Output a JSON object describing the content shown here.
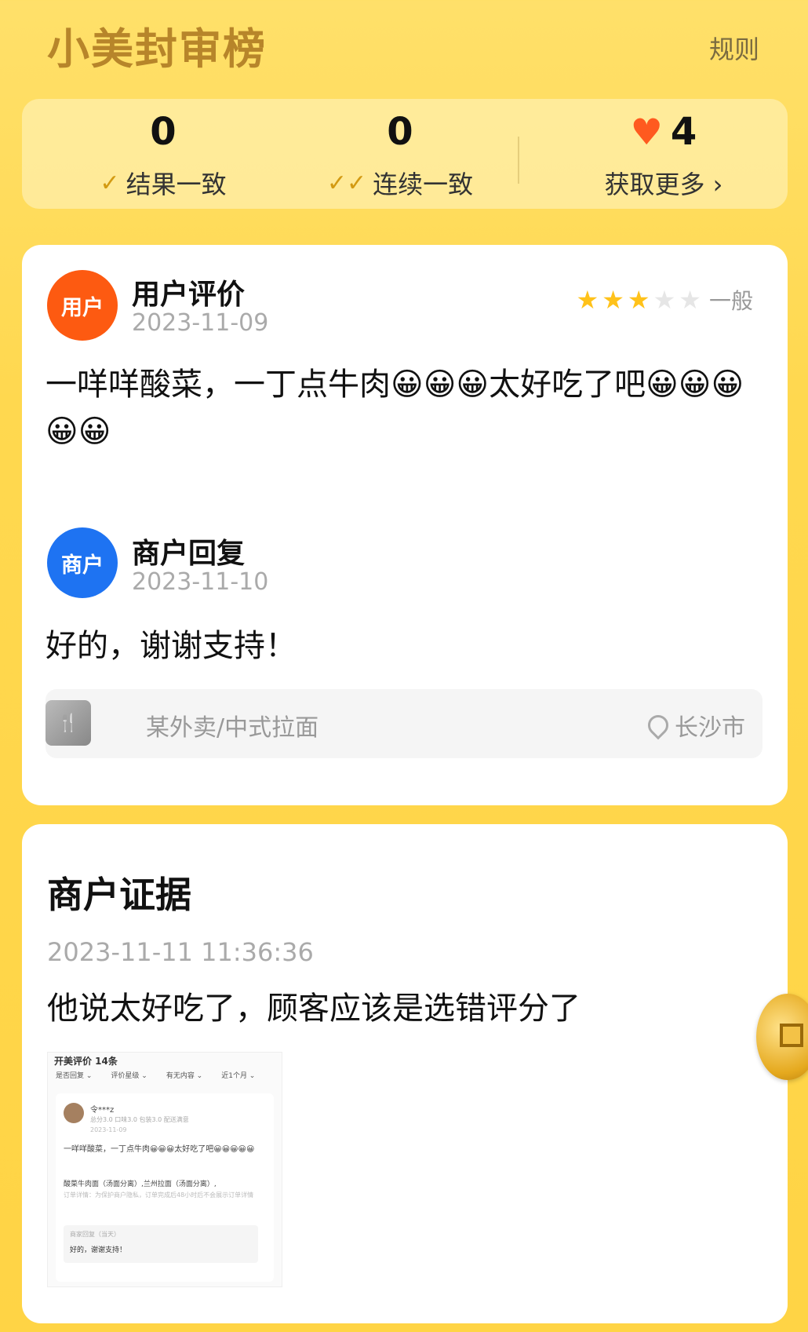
{
  "header": {
    "title": "小美封审榜",
    "rules": "规则"
  },
  "stats": {
    "consistent_result": {
      "value": "0",
      "label": "结果一致"
    },
    "consecutive": {
      "value": "0",
      "label": "连续一致"
    },
    "hearts": {
      "value": "4",
      "label": "获取更多 ›"
    }
  },
  "review": {
    "user_avatar": "用户",
    "user_title": "用户评价",
    "user_date": "2023-11-09",
    "rating_stars": 3,
    "rating_max": 5,
    "rating_text": "一般",
    "user_text": "一咩咩酸菜，一丁点牛肉😀😀😀太好吃了吧😀😀😀😀😀",
    "merchant_avatar": "商户",
    "merchant_title": "商户回复",
    "merchant_date": "2023-11-10",
    "merchant_text": "好的，谢谢支持！",
    "shop_category": "某外卖/中式拉面",
    "shop_location": "长沙市"
  },
  "evidence": {
    "title": "商户证据",
    "time": "2023-11-11 11:36:36",
    "text": "他说太好吃了，顾客应该是选错评分了",
    "thumb": {
      "header": "开美评价 14条",
      "filters": [
        "是否回复 ⌄",
        "评价星级 ⌄",
        "有无内容 ⌄",
        "近1个月 ⌄"
      ],
      "user": "令***z",
      "meta": "总分3.0  口味3.0  包装3.0  配送满意",
      "date": "2023-11-09",
      "review": "一咩咩酸菜，一丁点牛肉😀😀😀太好吃了吧😀😀😀😀😀",
      "dish": "酸菜牛肉面（汤面分离）,兰州拉面（汤面分离）,",
      "note": "订单详情：为保护商户隐私，订单完成后48小时后不会展示订单详情",
      "reply_header": "商家回复（当天）",
      "reply": "好的，谢谢支持！"
    }
  },
  "colors": {
    "background": "#ffd84f",
    "user_avatar": "#fd5a11",
    "merchant_avatar": "#1e73f2",
    "star": "#ffc21a",
    "heart": "#ff5a1f",
    "title_gold": "#b7852a"
  },
  "icons": {
    "check": "check-icon",
    "double_check": "double-check-icon",
    "heart": "heart-icon",
    "star": "star-icon",
    "location": "location-pin-icon",
    "coin": "coin-icon",
    "shop": "shop-icon"
  }
}
